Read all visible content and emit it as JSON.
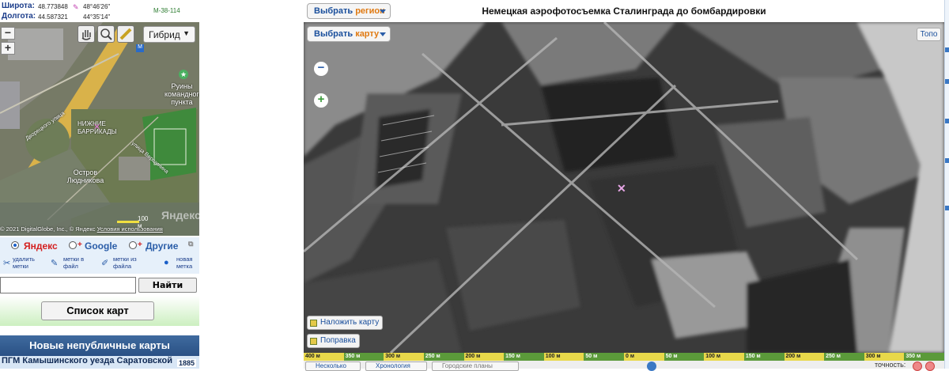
{
  "coords": {
    "lat_label": "Широта:",
    "lat_value": "48.773848",
    "lat_dms": "48°46'26\"",
    "lon_label": "Долгота:",
    "lon_value": "44.587321",
    "lon_dms": "44°35'14\"",
    "sheet": "M-38-114"
  },
  "minimap": {
    "layer_button": "Гибрид",
    "zoom_out": "−",
    "zoom_in": "+",
    "labels": {
      "ruins": "Руины командного пункта",
      "district": "НИЖНИЕ БАРРИКАДЫ",
      "island": "Остров Людникова",
      "street_a": "Дворецкого улица",
      "street_b": "улица Вершинина"
    },
    "scale": "100 м",
    "copyright": "© 2021 DigitalGlobe, Inc., © Яндекс",
    "terms": "Условия использования",
    "watermark": "Яндекс"
  },
  "providers": {
    "yandex": "Яндекс",
    "google": "Google",
    "other": "Другие",
    "selected": "Яндекс"
  },
  "tools": {
    "delete": "удалить метки",
    "to_file": "метки в файл",
    "from_file": "метки из файла",
    "new": "новая метка"
  },
  "search": {
    "value": "",
    "button": "Найти место"
  },
  "map_list_button": "Список карт",
  "new_maps": {
    "header": "Новые непубличные карты",
    "item": "ПГМ Камышинского уезда Саратовской",
    "year": "1885"
  },
  "header": {
    "select_region": "Выбрать",
    "select_region_accent": "регион",
    "title": "Немецкая аэрофотосъемка Сталинграда до бомбардировки"
  },
  "mainmap": {
    "select_map": "Выбрать",
    "select_map_accent": "карту",
    "topo": "Топо",
    "overlay": "Наложить карту",
    "correction": "Поправка",
    "zoom_out": "−",
    "zoom_in": "+"
  },
  "scale_labels": [
    "400 м",
    "350 м",
    "300 м",
    "250 м",
    "200 м",
    "150 м",
    "100 м",
    "50 м",
    "0 м",
    "50 м",
    "100 м",
    "150 м",
    "200 м",
    "250 м",
    "300 м",
    "350 м"
  ],
  "bottom": {
    "b1": "Несколько",
    "b2": "Хронология",
    "b3": "Городские планы",
    "accuracy": "точность:"
  },
  "colors": {
    "accent_blue": "#1a4f9c",
    "accent_orange": "#e07a12",
    "header_blue": "#2a5185",
    "scale_yellow": "#e8d84a",
    "scale_green": "#5b9a3a"
  }
}
